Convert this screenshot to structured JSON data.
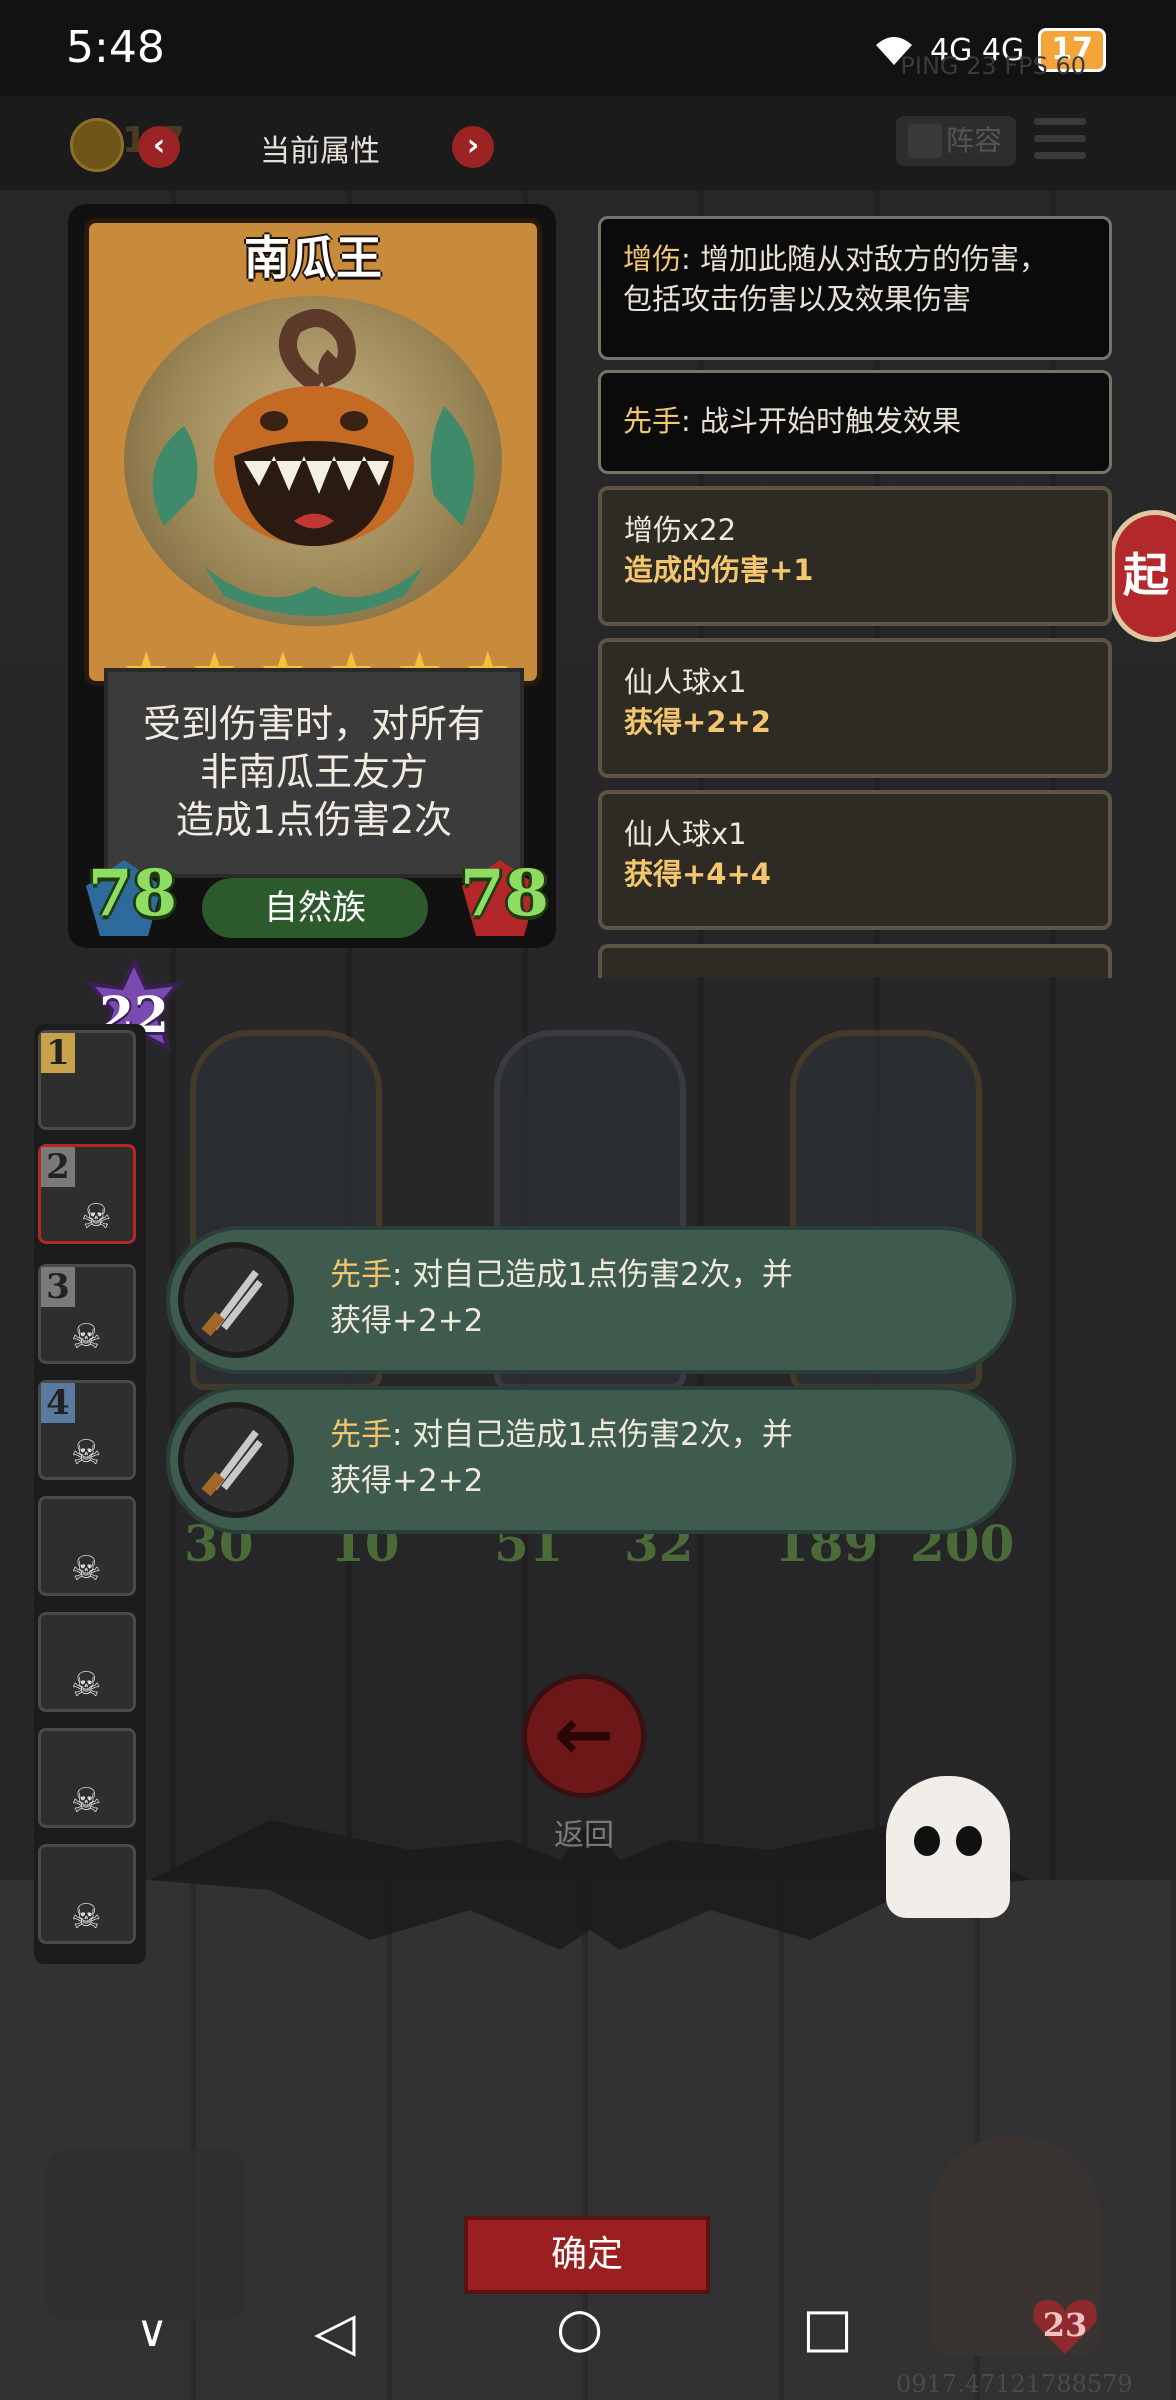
{
  "status_bar": {
    "time": "5:48",
    "network": "4G 4G",
    "battery": "17",
    "ping": "PING 23  FPS 60"
  },
  "top_bar": {
    "coin_text": "1 7",
    "title": "当前属性",
    "lineup_label": "阵容"
  },
  "card": {
    "name": "南瓜王",
    "stars": 6,
    "description_lines": [
      "受到伤害时，对所有",
      "非南瓜王友方",
      "造成1点伤害2次"
    ],
    "attack": "78",
    "health": "78",
    "tribe": "自然族",
    "level": "22"
  },
  "info_boxes": [
    {
      "keyword": "增伤",
      "text": ": 增加此随从对敌方的伤害，",
      "text2": "包括攻击伤害以及效果伤害"
    },
    {
      "keyword": "先手",
      "text": ": 战斗开始时触发效果"
    },
    {
      "line1": "增伤x22",
      "line2": "造成的伤害+1"
    },
    {
      "line1": "仙人球x1",
      "line2": "获得+2+2"
    },
    {
      "line1": "仙人球x1",
      "line2": "获得+4+4"
    }
  ],
  "side_list": [
    "1",
    "2",
    "3",
    "4",
    "",
    "",
    "",
    ""
  ],
  "side_button": "起",
  "team_stats": [
    {
      "atk": "30",
      "hp": "10"
    },
    {
      "atk": "51",
      "hp": "32"
    },
    {
      "atk": "189",
      "hp": "200"
    }
  ],
  "tooltips": [
    {
      "keyword": "先手",
      "text": ": 对自己造成1点伤害2次，并",
      "line2": "获得+2+2"
    },
    {
      "keyword": "先手",
      "text": ": 对自己造成1点伤害2次，并",
      "line2": "获得+2+2"
    }
  ],
  "return_label": "返回",
  "confirm_label": "确定",
  "hero_right_hp": "23",
  "watermark": "0917.47121788579",
  "nav": {
    "back": "◁",
    "home": "○",
    "recent": "□",
    "collapse": "∨"
  },
  "colors": {
    "keyword": "#f3c66f",
    "stat_green": "#8fdc63",
    "tooltip_green": "#3e5b4d",
    "button_red": "#9b1e20"
  },
  "icons": [
    "wifi-icon",
    "signal-icon",
    "battery-icon",
    "coin-icon",
    "arrow-left-icon",
    "arrow-right-icon",
    "book-icon",
    "menu-icon",
    "star-icon",
    "skull-icon",
    "shears-icon",
    "return-arrow-icon",
    "ghost-icon"
  ]
}
